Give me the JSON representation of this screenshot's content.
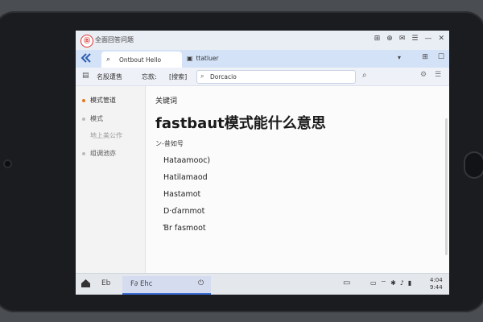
{
  "window": {
    "logo_text": "Ⓑ",
    "title": "全面回答问题",
    "controls": [
      "⊞",
      "⊕",
      "✉",
      "☰",
      "—",
      "✕"
    ]
  },
  "tabs": {
    "back_icon": "back-icon",
    "active_label": "Ontbout Hello",
    "second_label": "ttatluer",
    "dropdown": "▾",
    "right_icons": [
      "⊞",
      "☐"
    ]
  },
  "toolbar": {
    "label1": "名股遭售",
    "label2": "忘款:",
    "label3": "[搜索]",
    "search_value": "Dorcacio"
  },
  "sidebar": {
    "items": [
      {
        "label": "模式管道"
      },
      {
        "label": "模式"
      },
      {
        "label": "地上美公作"
      },
      {
        "label": "组调池亦"
      }
    ]
  },
  "content": {
    "section_label": "关键词",
    "headline": "fastbaut模式能什么意思",
    "list_header": "ン-昔如号",
    "items": [
      "Hataamooc)",
      "Hatilamaod",
      "Hastamot",
      "D·ɗarnmot",
      "Ɓr fasmoot"
    ]
  },
  "taskbar": {
    "app_label": "Eb",
    "active_label": "F∂ Ehc",
    "clock_time": "4:04",
    "clock_date": "9:44"
  }
}
